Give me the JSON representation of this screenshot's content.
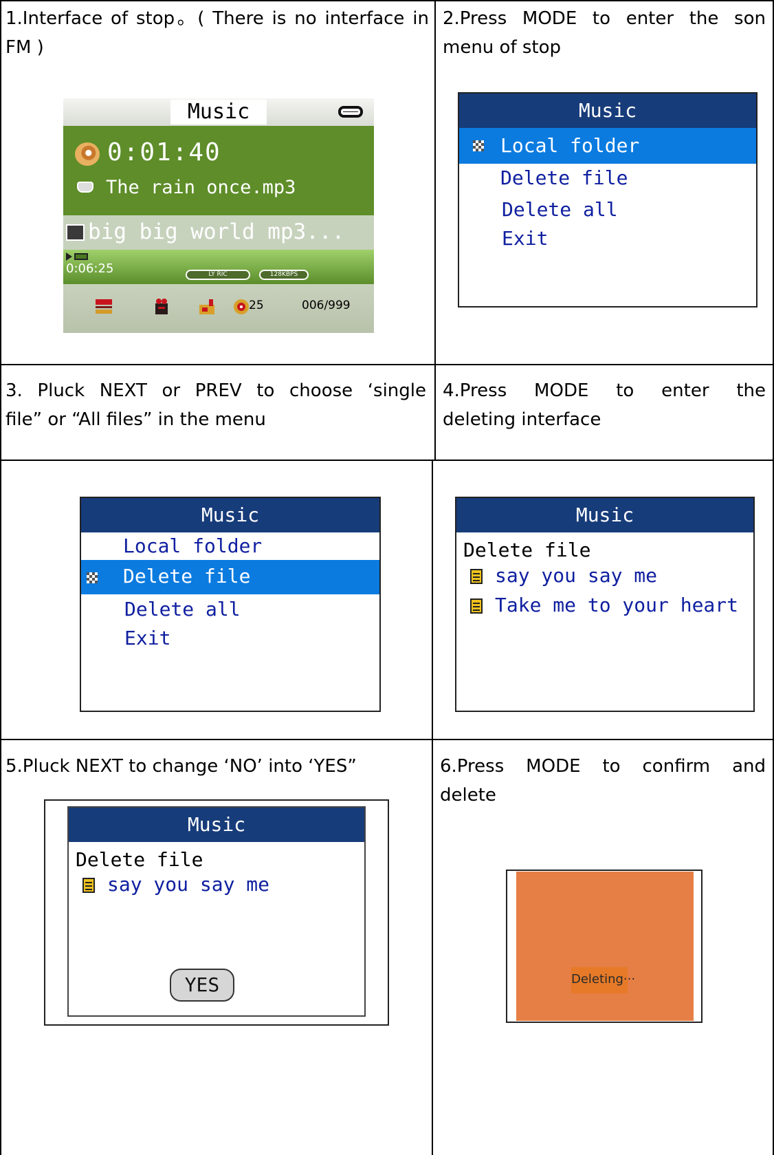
{
  "steps": [
    {
      "line1": "1.Interface of stop。( There is no interface in",
      "line2": "FM )"
    },
    {
      "line1": "2.Press MODE to enter the son",
      "line2": "menu of stop"
    },
    {
      "line1": "3. Pluck NEXT or PREV to choose ‘single",
      "line2": "file” or “All files” in the menu"
    },
    {
      "line1": "4.Press MODE to enter the",
      "line2": "deleting interface"
    },
    {
      "line1": "5.Pluck NEXT to change ‘NO’ into ‘YES”"
    },
    {
      "line1": "6.Press MODE to confirm and",
      "line2": "delete"
    }
  ],
  "player": {
    "title": "Music",
    "time": "0:01:40",
    "current_track": "The rain once.mp3",
    "next_track": "big big world mp3...",
    "elapsed": "0:06:25",
    "lyric_badge": "LY RIC",
    "bitrate_badge": "128KBPS",
    "volume": "25",
    "track_count": "006/999",
    "icons": [
      "disc-icon",
      "note-icon",
      "mtv-icon",
      "battery-icon",
      "play-icon",
      "eq-icon",
      "repeat-icon",
      "ab-icon",
      "volume-icon"
    ]
  },
  "menu": {
    "title": "Music",
    "items": [
      "Local folder",
      "Delete file",
      "Delete all",
      "Exit"
    ]
  },
  "delete_list": {
    "title": "Music",
    "heading": "Delete file",
    "files": [
      "say you say me",
      "Take me to your heart"
    ]
  },
  "confirm": {
    "title": "Music",
    "heading": "Delete file",
    "file": "say you say me",
    "button": "YES"
  },
  "deleting": {
    "text": "Deleting···"
  },
  "colors": {
    "header_blue": "#173c7a",
    "selection_blue": "#0b7be0",
    "item_blue": "#1020a0",
    "player_green": "#5e8d29",
    "deleting_orange": "#e67f45"
  }
}
